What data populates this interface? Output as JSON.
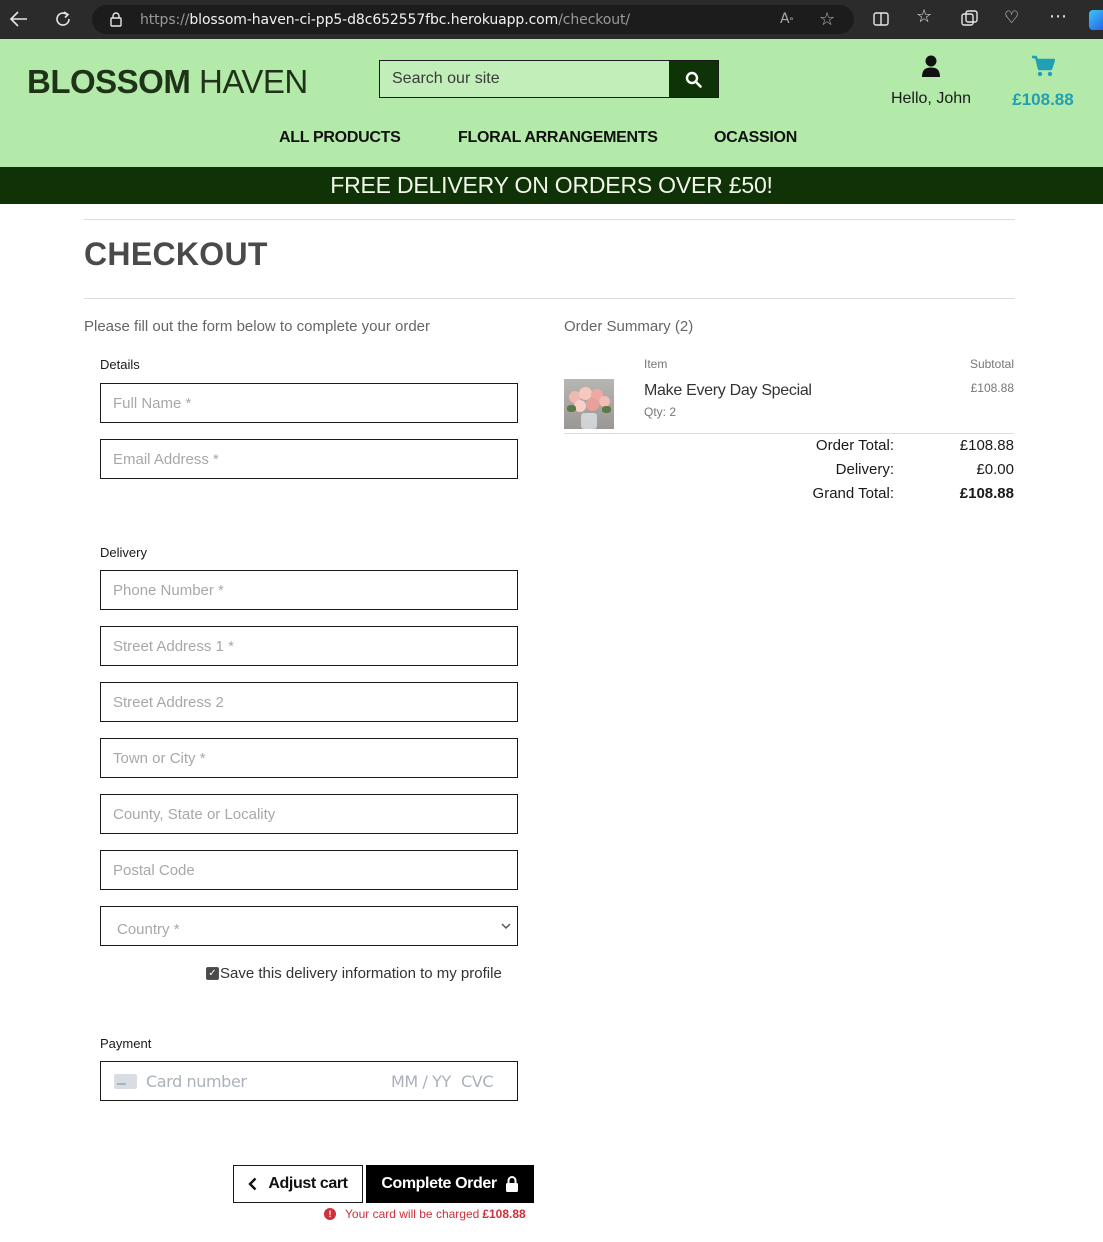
{
  "browser": {
    "url_prefix": "https://",
    "url_host": "blossom-haven-ci-pp5-d8c652557fbc.herokuapp.com",
    "url_path": "/checkout/",
    "icons": [
      "back-icon",
      "refresh-icon",
      "lock-icon",
      "read-aloud-icon",
      "favorite-icon",
      "split-screen-icon",
      "favorites-icon",
      "collections-icon",
      "performance-icon",
      "more-icon",
      "copilot-icon"
    ]
  },
  "header": {
    "logo_bold": "BLOSSOM",
    "logo_light": " HAVEN",
    "search_placeholder": "Search our site",
    "account_label": "Hello, John",
    "cart_total": "£108.88",
    "nav": [
      "ALL PRODUCTS",
      "FLORAL ARRANGEMENTS",
      "OCASSION"
    ],
    "colors": {
      "header_bg": "#b3eaaa",
      "banner_bg": "#0f3306",
      "cart_accent": "#21a0b5"
    }
  },
  "banner": {
    "text": "FREE DELIVERY ON ORDERS OVER £50!"
  },
  "checkout": {
    "title": "CHECKOUT",
    "intro": "Please fill out the form below to complete your order",
    "details_label": "Details",
    "details_fields": [
      "Full Name *",
      "Email Address *"
    ],
    "delivery_label": "Delivery",
    "delivery_fields": [
      "Phone Number *",
      "Street Address 1 *",
      "Street Address 2",
      "Town or City *",
      "County, State or Locality",
      "Postal Code"
    ],
    "country_placeholder": "Country *",
    "save_label": "Save this delivery information to my profile",
    "save_checked": true,
    "payment_label": "Payment",
    "card_placeholder": "Card number",
    "card_expiry": "MM / YY",
    "card_cvc": "CVC",
    "adjust_label": "Adjust cart",
    "complete_label": "Complete Order",
    "charge_note": "Your card will be charged ",
    "charge_amount": "£108.88"
  },
  "summary": {
    "title": "Order Summary (2)",
    "col_item": "Item",
    "col_subtotal": "Subtotal",
    "items": [
      {
        "name": "Make Every Day Special",
        "qty": "Qty: 2",
        "subtotal": "£108.88"
      }
    ],
    "order_total_label": "Order Total:",
    "order_total": "£108.88",
    "delivery_label": "Delivery:",
    "delivery": "£0.00",
    "grand_total_label": "Grand Total:",
    "grand_total": "£108.88"
  }
}
